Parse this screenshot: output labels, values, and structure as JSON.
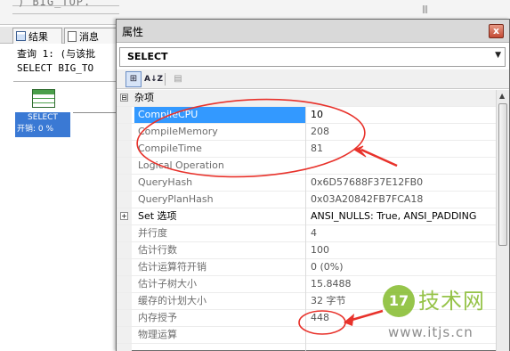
{
  "background": {
    "editor_text": ") BIG_TOP.",
    "tabs": [
      {
        "label": "结果"
      },
      {
        "label": "消息"
      }
    ],
    "results_lines": [
      "查询 1: (与该批",
      "SELECT BIG_TO"
    ],
    "node": {
      "label": "SELECT",
      "cost": "开销: 0 %"
    }
  },
  "properties": {
    "title": "属性",
    "close_glyph": "x",
    "object": "SELECT",
    "toolbar": {
      "categorized_glyph": "⊞",
      "alphabetical_glyph": "A↓Z",
      "pages_glyph": "▤"
    },
    "rows": [
      {
        "type": "category",
        "expander": "⊟",
        "label": "杂项"
      },
      {
        "name": "CompileCPU",
        "value": "10",
        "selected": true
      },
      {
        "name": "CompileMemory",
        "value": "208"
      },
      {
        "name": "CompileTime",
        "value": "81"
      },
      {
        "name": "Logical Operation",
        "value": ""
      },
      {
        "name": "QueryHash",
        "value": "0x6D57688F37E12FB0",
        "dim": true
      },
      {
        "name": "QueryPlanHash",
        "value": "0x03A20842FB7FCA18",
        "dim": true
      },
      {
        "type": "expandable",
        "expander": "+",
        "name": "Set 选项",
        "value": "ANSI_NULLS: True, ANSI_PADDING"
      },
      {
        "name": "并行度",
        "value": "4"
      },
      {
        "name": "估计行数",
        "value": "100"
      },
      {
        "name": "估计运算符开销",
        "value": "0 (0%)"
      },
      {
        "name": "估计子树大小",
        "value": "15.8488"
      },
      {
        "name": "缓存的计划大小",
        "value": "32 字节"
      },
      {
        "name": "内存授予",
        "value": "448"
      },
      {
        "name": "物理运算",
        "value": ""
      }
    ]
  },
  "annotation_colors": {
    "highlight": "#e8322b"
  },
  "watermark": {
    "logo_text": "17",
    "text": "技术网",
    "url": "www.itjs.cn"
  }
}
